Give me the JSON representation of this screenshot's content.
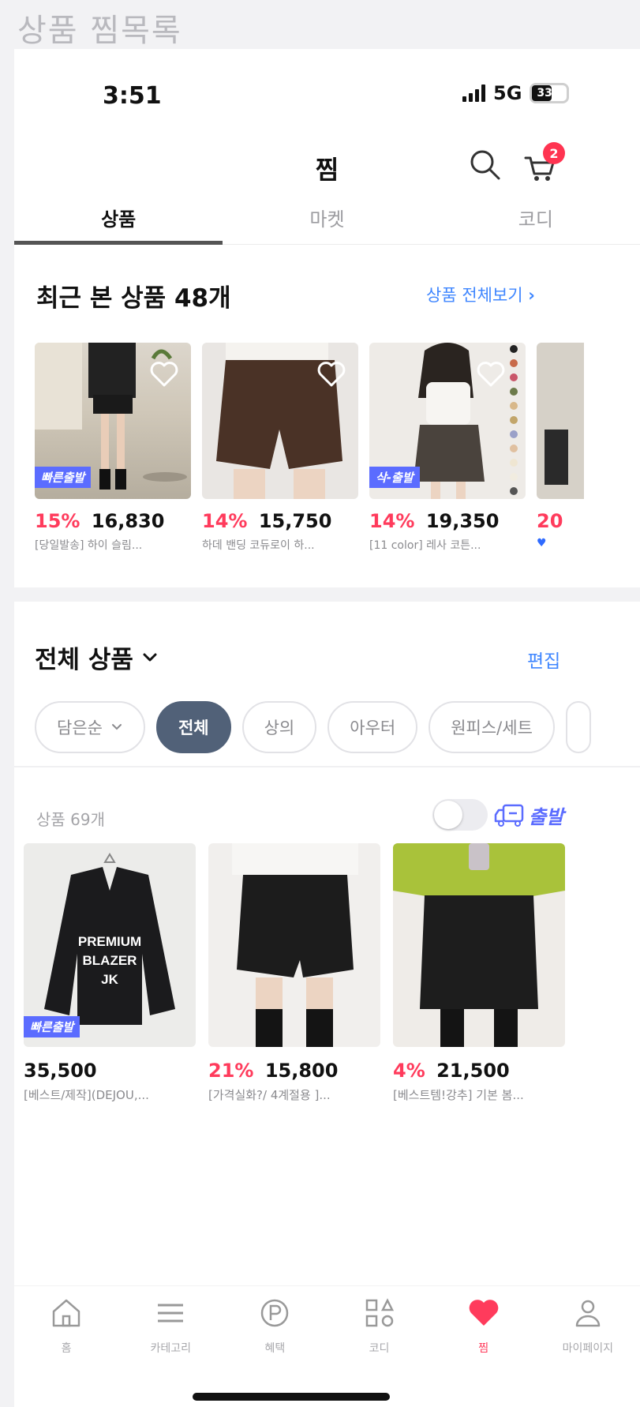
{
  "outer_title": "상품 찜목록",
  "status": {
    "time": "3:51",
    "network": "5G",
    "battery": "33"
  },
  "header": {
    "title": "찜",
    "cart_count": "2"
  },
  "tabs": [
    {
      "label": "상품",
      "active": true
    },
    {
      "label": "마켓",
      "active": false
    },
    {
      "label": "코디",
      "active": false
    }
  ],
  "recent": {
    "title": "최근 본 상품 48개",
    "see_all": "상품 전체보기",
    "items": [
      {
        "discount": "15%",
        "price": "16,830",
        "name": "[당일발송] 하이 슬림...",
        "tag": "빠른출발"
      },
      {
        "discount": "14%",
        "price": "15,750",
        "name": "하데 밴딩 코듀로이 하...",
        "tag": ""
      },
      {
        "discount": "14%",
        "price": "19,350",
        "name": "[11 color] 레사 코튼...",
        "tag": "삭-출발"
      },
      {
        "discount": "20",
        "price": "",
        "name": "",
        "tag": ""
      }
    ]
  },
  "all_products": {
    "title": "전체 상품",
    "edit": "편집",
    "chips": [
      {
        "label": "담은순",
        "active": false
      },
      {
        "label": "전체",
        "active": true
      },
      {
        "label": "상의",
        "active": false
      },
      {
        "label": "아우터",
        "active": false
      },
      {
        "label": "원피스/세트",
        "active": false
      }
    ],
    "count": "상품 69개",
    "delivery_label": "출발",
    "items": [
      {
        "discount": "",
        "price": "35,500",
        "name": "[베스트/제작](DEJOU,...",
        "tag": "빠른출발",
        "overlay": [
          "PREMIUM",
          "BLAZER",
          "JK"
        ]
      },
      {
        "discount": "21%",
        "price": "15,800",
        "name": "[가격실화?/ 4계절용 ]...",
        "tag": "",
        "overlay": []
      },
      {
        "discount": "4%",
        "price": "21,500",
        "name": "[베스트템!강추] 기본 봄...",
        "tag": "",
        "overlay": []
      }
    ]
  },
  "bottom_nav": [
    {
      "label": "홈",
      "icon": "home-icon",
      "active": false
    },
    {
      "label": "카테고리",
      "icon": "menu-icon",
      "active": false
    },
    {
      "label": "혜택",
      "icon": "point-icon",
      "active": false
    },
    {
      "label": "코디",
      "icon": "grid-icon",
      "active": false
    },
    {
      "label": "찜",
      "icon": "heart-icon",
      "active": true
    },
    {
      "label": "마이페이지",
      "icon": "user-icon",
      "active": false
    }
  ],
  "colors": {
    "accent_red": "#ff3b5c",
    "link_blue": "#3f86ff",
    "chip_active": "#516178",
    "tag_purple": "#5b6cff"
  }
}
